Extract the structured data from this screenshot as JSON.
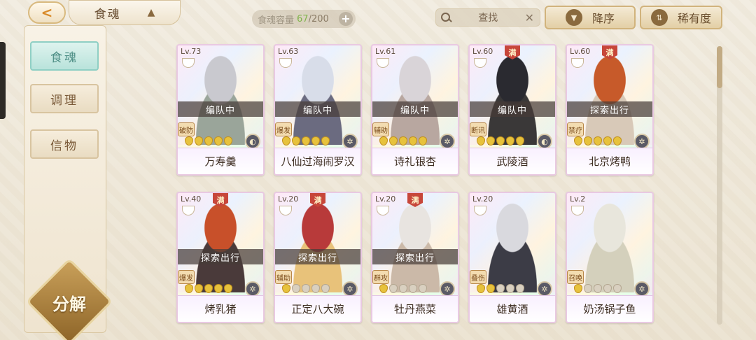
{
  "header": {
    "back_icon": "back-arrow-icon",
    "title": "食魂",
    "capacity_label": "食魂容量",
    "capacity_current": "67",
    "capacity_max": "/200",
    "capacity_add": "+",
    "search_placeholder": "查找",
    "search_clear": "✕",
    "sort_desc_label": "降序",
    "sort_desc_icon": "▼",
    "sort_rarity_label": "稀有度",
    "sort_rarity_icon": "⇅"
  },
  "sidebar": {
    "tabs": [
      {
        "label": "食魂",
        "active": true
      },
      {
        "label": "调理",
        "active": false
      },
      {
        "label": "信物",
        "active": false
      }
    ],
    "decompose_label": "分解"
  },
  "full_badge": "满",
  "cards": [
    {
      "level": "Lv.73",
      "name": "万寿羹",
      "status": "编队中",
      "role": "破防",
      "full": false,
      "stars": 5,
      "max_stars": 5,
      "element": "◐",
      "hair": "#c9c9cf",
      "robe": "#9aa59a"
    },
    {
      "level": "Lv.63",
      "name": "八仙过海闹罗汉",
      "status": "编队中",
      "role": "爆发",
      "full": false,
      "stars": 5,
      "max_stars": 5,
      "element": "✲",
      "hair": "#d8dde9",
      "robe": "#6b6b80"
    },
    {
      "level": "Lv.61",
      "name": "诗礼银杏",
      "status": "编队中",
      "role": "辅助",
      "full": false,
      "stars": 5,
      "max_stars": 5,
      "element": "✲",
      "hair": "#d9d4d8",
      "robe": "#b8a7a0"
    },
    {
      "level": "Lv.60",
      "name": "武陵酒",
      "status": "编队中",
      "role": "断讯",
      "full": true,
      "stars": 5,
      "max_stars": 5,
      "element": "◐",
      "hair": "#2a2a30",
      "robe": "#3a3838"
    },
    {
      "level": "Lv.60",
      "name": "北京烤鸭",
      "status": "探索出行",
      "role": "禁疗",
      "full": true,
      "stars": 5,
      "max_stars": 5,
      "element": "✲",
      "hair": "#c75a2a",
      "robe": "#d8c9b8"
    },
    {
      "level": "Lv.40",
      "name": "烤乳猪",
      "status": "探索出行",
      "role": "爆发",
      "full": true,
      "stars": 5,
      "max_stars": 5,
      "element": "✲",
      "hair": "#c8502a",
      "robe": "#4a3a3a"
    },
    {
      "level": "Lv.20",
      "name": "正定八大碗",
      "status": "探索出行",
      "role": "辅助",
      "full": true,
      "stars": 1,
      "max_stars": 5,
      "element": "✲",
      "hair": "#b83a3a",
      "robe": "#e8c27a"
    },
    {
      "level": "Lv.20",
      "name": "牡丹燕菜",
      "status": "探索出行",
      "role": "群攻",
      "full": true,
      "stars": 1,
      "max_stars": 5,
      "element": "✲",
      "hair": "#e8e4e0",
      "robe": "#cbb9a8"
    },
    {
      "level": "Lv.20",
      "name": "雄黄酒",
      "status": "",
      "role": "叠伤",
      "full": false,
      "stars": 2,
      "max_stars": 5,
      "element": "✲",
      "hair": "#d9d9de",
      "robe": "#3c3c46"
    },
    {
      "level": "Lv.2",
      "name": "奶汤锅子鱼",
      "status": "",
      "role": "召唤",
      "full": false,
      "stars": 1,
      "max_stars": 5,
      "element": "✲",
      "hair": "#e8e6dc",
      "robe": "#d4d0bc"
    }
  ]
}
